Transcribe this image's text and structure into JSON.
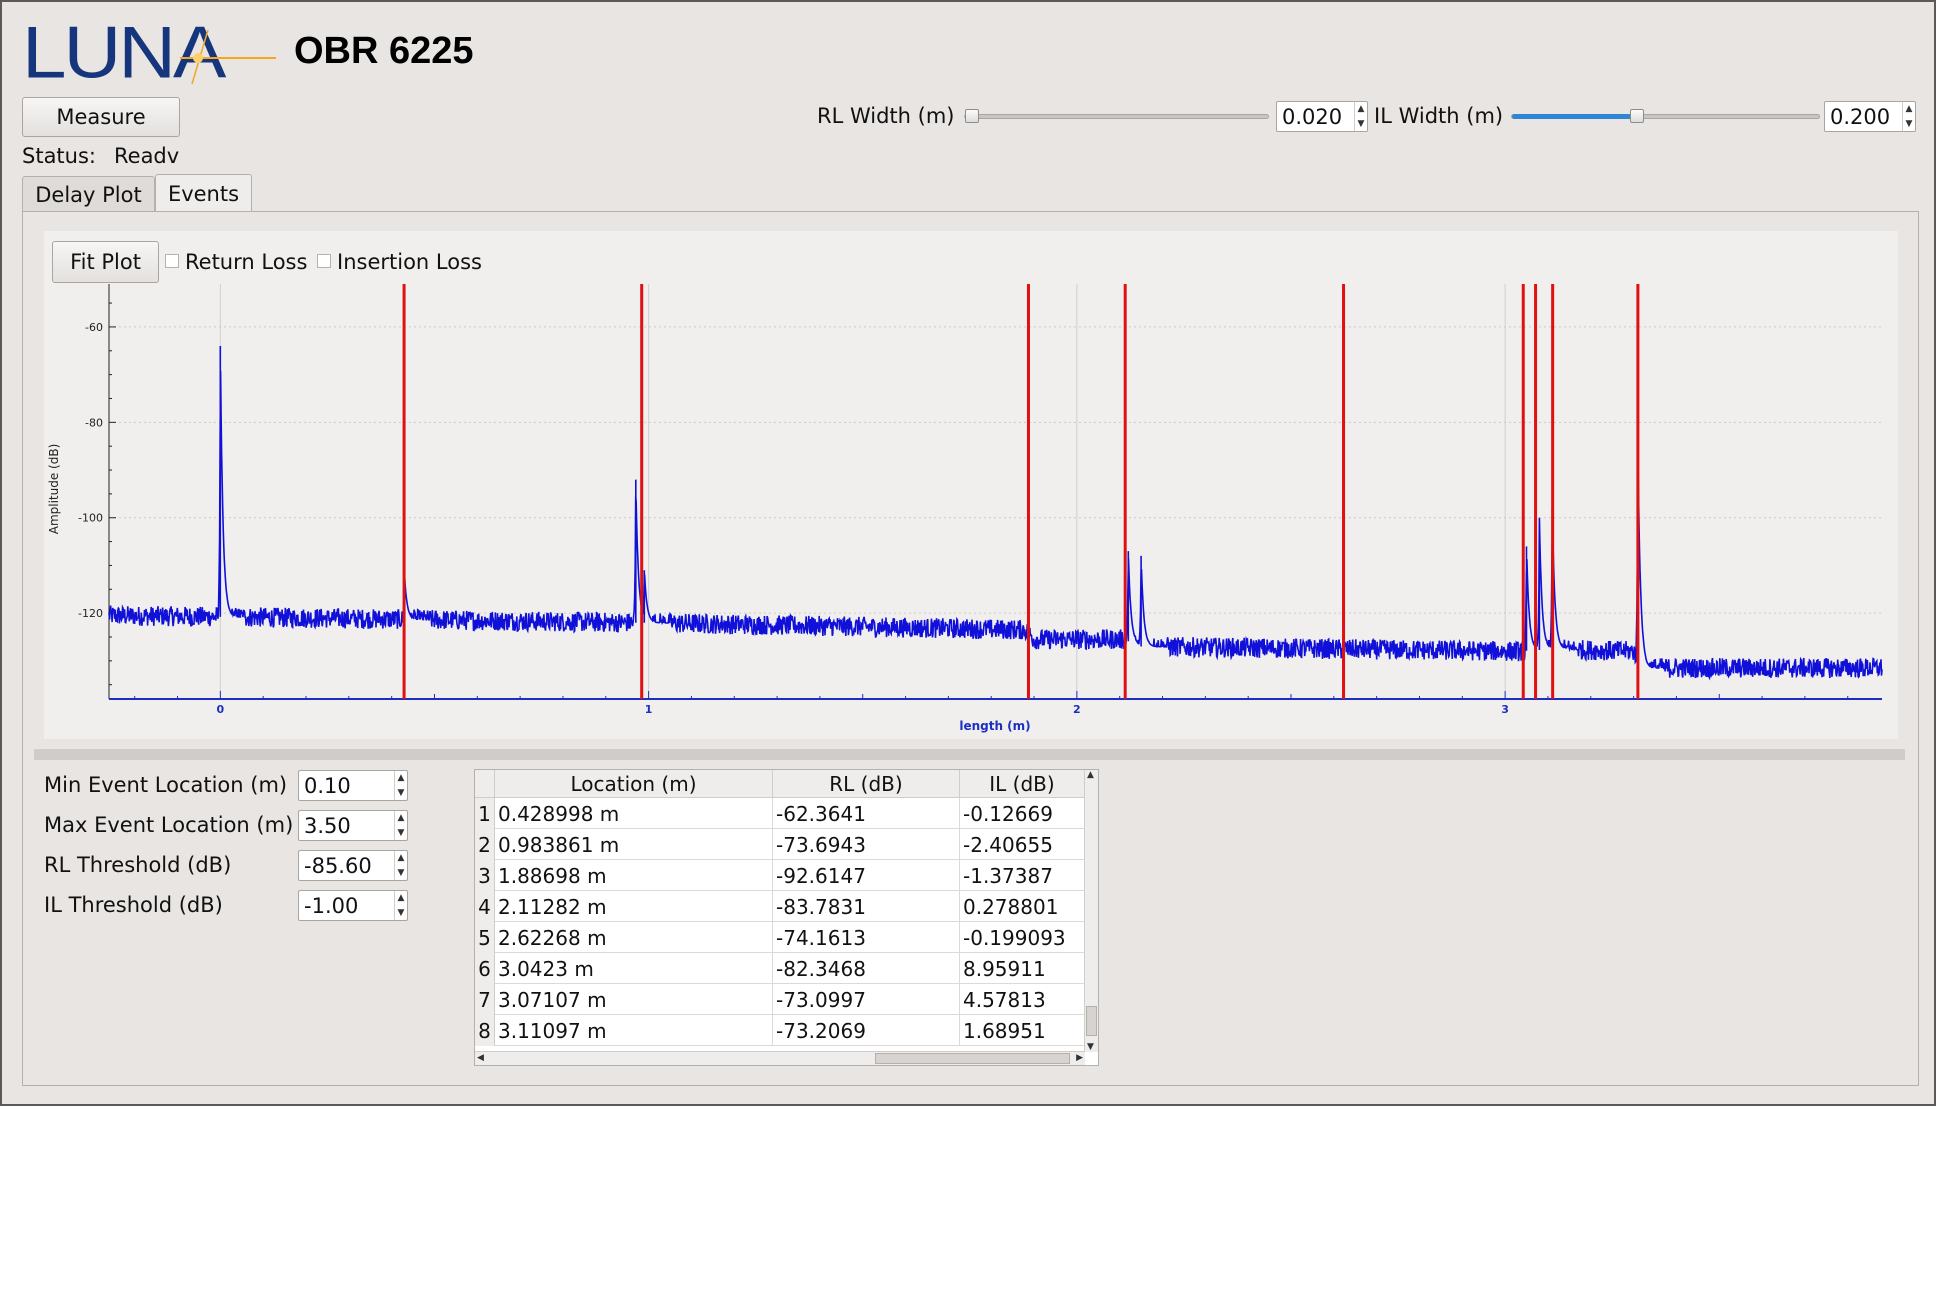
{
  "app": {
    "logo_text": "LUNA",
    "title": "OBR 6225",
    "measure_label": "Measure",
    "status_label": "Status:",
    "status_value": "Readv"
  },
  "widths": {
    "rl_label": "RL Width (m)",
    "rl_value": "0.020",
    "rl_level": 0.0,
    "il_label": "IL Width (m)",
    "il_value": "0.200",
    "il_level": 0.4
  },
  "tabs": [
    "Delay Plot",
    "Events"
  ],
  "active_tab": "Events",
  "plot": {
    "fit_label": "Fit Plot",
    "return_loss_label": "Return Loss",
    "return_loss_checked": false,
    "insertion_loss_label": "Insertion Loss",
    "insertion_loss_checked": false
  },
  "chart_data": {
    "type": "line",
    "xlabel": "length (m)",
    "ylabel": "Amplitude (dB)",
    "xlim": [
      -0.26,
      3.88
    ],
    "ylim": [
      -138,
      -51
    ],
    "xticks": [
      0,
      1,
      2,
      3
    ],
    "yticks": [
      -60,
      -80,
      -100,
      -120
    ],
    "grid": true,
    "series_color": "#1010d8",
    "marker_color": "#e01010",
    "baseline": [
      {
        "x": -0.26,
        "y": -120.5
      },
      {
        "x": 0.2,
        "y": -121
      },
      {
        "x": 0.95,
        "y": -122
      },
      {
        "x": 1.0,
        "y": -122
      },
      {
        "x": 1.88,
        "y": -123.5
      },
      {
        "x": 1.9,
        "y": -125.5
      },
      {
        "x": 2.11,
        "y": -125.5
      },
      {
        "x": 2.15,
        "y": -127
      },
      {
        "x": 3.03,
        "y": -128
      },
      {
        "x": 3.12,
        "y": -127.5
      },
      {
        "x": 3.3,
        "y": -128
      },
      {
        "x": 3.33,
        "y": -131.5
      },
      {
        "x": 3.88,
        "y": -131.5
      }
    ],
    "peaks": [
      {
        "x": 0.0,
        "y": -64
      },
      {
        "x": 0.43,
        "y": -112
      },
      {
        "x": 0.97,
        "y": -92
      },
      {
        "x": 0.99,
        "y": -111
      },
      {
        "x": 2.12,
        "y": -107
      },
      {
        "x": 2.15,
        "y": -108
      },
      {
        "x": 3.05,
        "y": -106
      },
      {
        "x": 3.08,
        "y": -100
      },
      {
        "x": 3.11,
        "y": -98
      },
      {
        "x": 3.31,
        "y": -86
      }
    ],
    "event_markers": [
      0.428998,
      0.983861,
      1.88698,
      2.11282,
      2.62268,
      3.0423,
      3.07107,
      3.11097,
      3.31
    ]
  },
  "params": [
    {
      "label": "Min Event Location (m)",
      "value": "0.10"
    },
    {
      "label": "Max Event Location (m)",
      "value": "3.50"
    },
    {
      "label": "RL Threshold (dB)",
      "value": "-85.60"
    },
    {
      "label": "IL Threshold (dB)",
      "value": "-1.00"
    }
  ],
  "events_table": {
    "columns": [
      "Location (m)",
      "RL (dB)",
      "IL (dB)"
    ],
    "rows": [
      {
        "n": "1",
        "loc": "0.428998 m",
        "rl": "-62.3641",
        "il": "-0.12669"
      },
      {
        "n": "2",
        "loc": "0.983861 m",
        "rl": "-73.6943",
        "il": "-2.40655"
      },
      {
        "n": "3",
        "loc": "1.88698 m",
        "rl": "-92.6147",
        "il": "-1.37387"
      },
      {
        "n": "4",
        "loc": "2.11282 m",
        "rl": "-83.7831",
        "il": "0.278801"
      },
      {
        "n": "5",
        "loc": "2.62268 m",
        "rl": "-74.1613",
        "il": "-0.199093"
      },
      {
        "n": "6",
        "loc": "3.0423 m",
        "rl": "-82.3468",
        "il": "8.95911"
      },
      {
        "n": "7",
        "loc": "3.07107 m",
        "rl": "-73.0997",
        "il": "4.57813"
      },
      {
        "n": "8",
        "loc": "3.11097 m",
        "rl": "-73.2069",
        "il": "1.68951"
      }
    ]
  }
}
